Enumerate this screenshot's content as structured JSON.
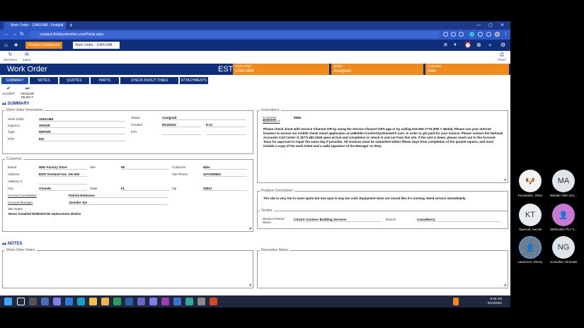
{
  "browser": {
    "tab_title": "Work Order - 10401488 - Fieldp...",
    "url": "cssatest.fieldpointonline.com/Portal.aspx"
  },
  "appbar": {
    "provider_dashboard": "Provider Dashboard",
    "work_order_search": "Work Order - 10401488"
  },
  "toolbar": {
    "refresh": "REFRESH",
    "email": "EMAIL",
    "print": "PRINT"
  },
  "header": {
    "title": "Work Order",
    "est": "EST",
    "work_order_label": "Work Order",
    "work_order_value": "10401488",
    "status_label": "Status",
    "status_value": "Assigned",
    "customer_label": "Customer",
    "customer_value": "Nike"
  },
  "tabs": [
    "SUMMARY",
    "NOTES",
    "QUOTES",
    "PARTS",
    "CHECK-IN/OUT TIMES",
    "ATTACHMENTS"
  ],
  "actions": {
    "accept": "ACCEPT",
    "vendor_reject": "VENDOR REJECT"
  },
  "summary": {
    "section_label": "SUMMARY",
    "wo_info_title": "Work Order Information",
    "work_order_lbl": "Work Order",
    "work_order": "10401488",
    "urgency_lbl": "Urgency",
    "urgency": "3HOUR",
    "type_lbl": "Type",
    "type": "REPAIR",
    "nte_lbl": "NTE",
    "nte": "810",
    "status_lbl": "Status",
    "status": "Assigned",
    "created_lbl": "Created",
    "created_date": "8/13/2022",
    "created_time": "8:13",
    "eta_lbl": "ETA",
    "instructions_title": "Instructions",
    "customer_ref_lbl": "Customer Reference #",
    "customer_ref": "5555",
    "instructions_text": "Please check in/out with Service Channel IVR by using the Service Channel GPS app or by calling 516-500-7776 (PIN # 39153). Please use your internet browser to access our mobile check in/out application at saMobile.ComfortSystemsUSA.com. In order to get paid for your invoice, Please contact the National Accounts Call Center @ (877) 482-2549 upon arrival and completion to check in and out from this site. If the unit is down, please reach out to the Account Team for approval to repair the same day if possible. All invoices must be submitted within fifteen days from completion of the quoted repairs, and must include a copy of the work ticket and a valid signature of the Manager on duty.",
    "customer_title": "Customer",
    "brand_lbl": "Brand",
    "brand": "Nike Factory Store",
    "site_lbl": "Site",
    "site": "96",
    "customer_lbl": "Customer",
    "customer": "Nike",
    "address_lbl": "Address",
    "address": "8200 Vineland Ave. Ste 600",
    "site_phone_lbl": "Site Phone",
    "site_phone": "4072393663",
    "address2_lbl": "Address 2",
    "city_lbl": "City",
    "city": "Orlando",
    "state_lbl": "State",
    "state": "FL",
    "zip_lbl": "Zip",
    "zip": "32821",
    "account_coordinator_lbl": "Account Coordinator",
    "account_coordinator": "Patrick Robinson",
    "account_manager_lbl": "Account Manager",
    "account_manager": "Jennifer Tye",
    "site_notes_lbl": "Site Notes",
    "site_notes": "Never installed 8/28/10UCM replacement 3/24/11",
    "problem_title": "Problem Description",
    "problem_text": "The site is very hot in most spots but one spot is way too cold.  Equipment does not sound like it's running.  Need service immediately.",
    "vendor_title": "Vendor",
    "service_partner_lbl": "Service Partner Name",
    "service_partner": "CSUSA ConServ Building Services",
    "branch_lbl": "Branch",
    "branch": "Casselberry"
  },
  "notes": {
    "section_label": "NOTES",
    "wo_notes_title": "Work Order Notes",
    "resolution_title": "Resolution Notes"
  },
  "participants": [
    {
      "name": "Fernandez, Shari",
      "initials": ""
    },
    {
      "name": "Mandie Allen (Gu...",
      "initials": "MA"
    },
    {
      "name": "Tapscott, Karrah",
      "initials": "KT"
    },
    {
      "name": "583bca94-7f17-4...",
      "initials": ""
    },
    {
      "name": "Lawrence, Denny",
      "initials": ""
    },
    {
      "name": "Gonzales, Nicholas",
      "initials": "NG"
    }
  ],
  "clock": {
    "time": "9:29 AM",
    "date": "8/13/2022"
  },
  "colors": {
    "navy": "#0f2f7a",
    "orange": "#f08a1c",
    "browser_blue": "#2f59c9"
  }
}
